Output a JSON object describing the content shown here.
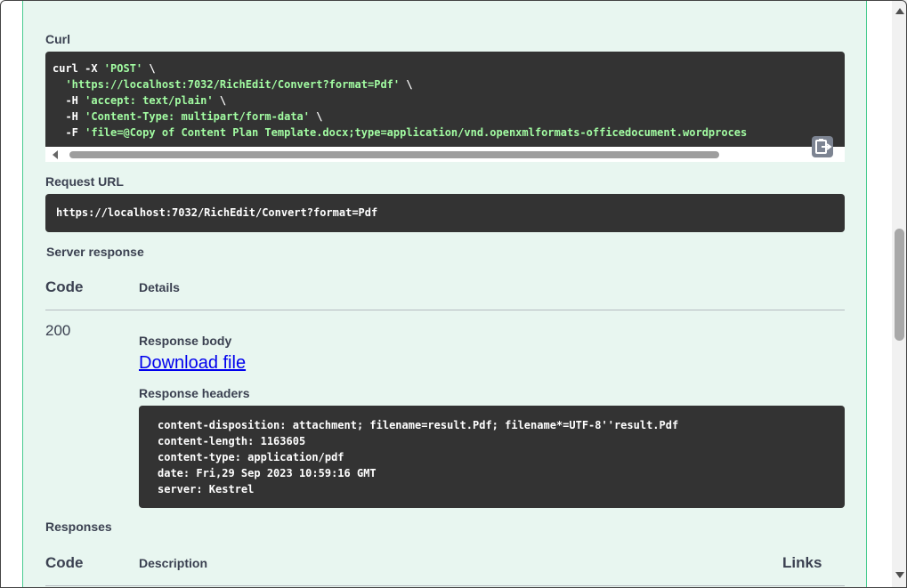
{
  "curl": {
    "label": "Curl",
    "lines": [
      {
        "plain": "curl -X ",
        "str": "'POST'",
        "tail": " \\"
      },
      {
        "plain": "  ",
        "str": "'https://localhost:7032/RichEdit/Convert?format=Pdf'",
        "tail": " \\"
      },
      {
        "plain": "  -H ",
        "str": "'accept: text/plain'",
        "tail": " \\"
      },
      {
        "plain": "  -H ",
        "str": "'Content-Type: multipart/form-data'",
        "tail": " \\"
      },
      {
        "plain": "  -F ",
        "str": "'file=@Copy of Content Plan Template.docx;type=application/vnd.openxmlformats-officedocument.wordproces",
        "tail": ""
      }
    ],
    "copy_icon": "clipboard-copy-icon"
  },
  "request_url": {
    "label": "Request URL",
    "value": "https://localhost:7032/RichEdit/Convert?format=Pdf"
  },
  "server_response": {
    "label": "Server response",
    "col_code": "Code",
    "col_details": "Details",
    "code": "200",
    "body_label": "Response body",
    "download_link": "Download file",
    "headers_label": "Response headers",
    "headers": [
      "content-disposition: attachment; filename=result.Pdf; filename*=UTF-8''result.Pdf",
      "content-length: 1163605",
      "content-type: application/pdf",
      "date: Fri,29 Sep 2023 10:59:16 GMT",
      "server: Kestrel"
    ]
  },
  "responses": {
    "label": "Responses",
    "col_code": "Code",
    "col_description": "Description",
    "col_links": "Links"
  },
  "colors": {
    "accent": "#49cc90",
    "panel_bg": "#e8f6f0",
    "code_bg": "#333333",
    "string_color": "#a2fca2",
    "link": "#0000ee"
  }
}
